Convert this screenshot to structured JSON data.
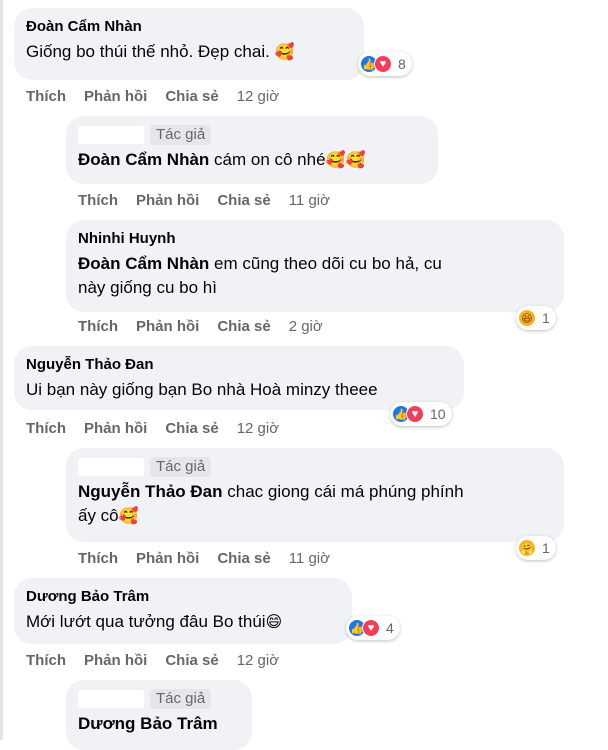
{
  "comments": [
    {
      "author": "Đoàn Cẩm Nhàn",
      "text": "Giống bo thúi thế nhỏ. Đẹp chai.",
      "emoji": "🥰",
      "reactions": {
        "count": "8"
      },
      "actions": {
        "like": "Thích",
        "reply": "Phản hồi",
        "share": "Chia sẻ",
        "time": "12 giờ"
      }
    },
    {
      "badge": "Tác giả",
      "mention": "Đoàn Cẩm Nhàn",
      "text": "cám on cô nhé",
      "emoji": "🥰🥰",
      "actions": {
        "like": "Thích",
        "reply": "Phản hồi",
        "share": "Chia sẻ",
        "time": "11 giờ"
      }
    },
    {
      "author": "Nhinhi Huynh",
      "mention": "Đoàn Cẩm Nhàn",
      "text_line1": "em cũng theo dõi cu bo hả, cu",
      "text_line2": "này giống cu bo hì",
      "reactions": {
        "count": "1"
      },
      "actions": {
        "like": "Thích",
        "reply": "Phản hồi",
        "share": "Chia sẻ",
        "time": "2 giờ"
      }
    },
    {
      "author": "Nguyễn Thảo Đan",
      "text": "Ui bạn này giống bạn Bo nhà Hoà minzy theee",
      "reactions": {
        "count": "10"
      },
      "actions": {
        "like": "Thích",
        "reply": "Phản hồi",
        "share": "Chia sẻ",
        "time": "12 giờ"
      }
    },
    {
      "badge": "Tác giả",
      "mention": "Nguyễn Thảo Đan",
      "text_line1": "chac giong cái má phúng phính",
      "text_line2": "ấy cô",
      "emoji": "🥰",
      "reactions": {
        "count": "1"
      },
      "actions": {
        "like": "Thích",
        "reply": "Phản hồi",
        "share": "Chia sẻ",
        "time": "11 giờ"
      }
    },
    {
      "author": "Dương Bảo Trâm",
      "text": "Mới lướt qua tưởng đâu Bo thúi",
      "emoji": "😄",
      "reactions": {
        "count": "4"
      },
      "actions": {
        "like": "Thích",
        "reply": "Phản hồi",
        "share": "Chia sẻ",
        "time": "12 giờ"
      }
    },
    {
      "badge": "Tác giả",
      "mention": "Dương Bảo Trâm"
    }
  ],
  "colors": {
    "bubble": "#f0f2f5",
    "secondary_text": "#65676b",
    "like_blue": "#1877f2",
    "love_red": "#f33e58",
    "haha_yellow": "#f7b125"
  },
  "icons": {
    "like": "like-reaction-icon",
    "love": "love-reaction-icon",
    "haha": "haha-reaction-icon",
    "care": "care-reaction-icon"
  }
}
